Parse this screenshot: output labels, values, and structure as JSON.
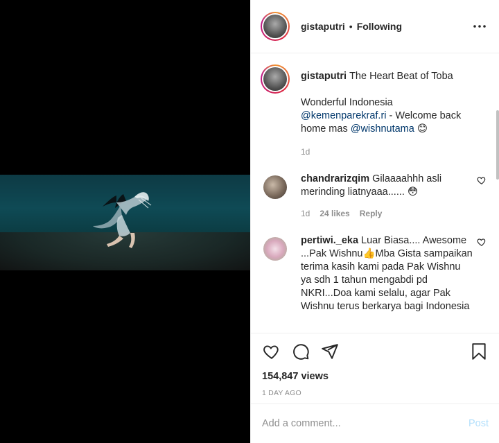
{
  "header": {
    "username": "gistaputri",
    "separator": "•",
    "follow_status": "Following"
  },
  "caption": {
    "username": "gistaputri",
    "title": "The Heart Beat of Toba",
    "line1": "Wonderful Indonesia",
    "mention1": "@kemenparekraf.ri",
    "mid_text": " - Welcome back home mas ",
    "mention2": "@wishnutama",
    "emoji": "😊",
    "time": "1d"
  },
  "comments": [
    {
      "username": "chandrarizqim",
      "text": "Gilaaaahhh asli merinding liatnyaaa...... 😳",
      "time": "1d",
      "likes": "24 likes",
      "reply": "Reply"
    },
    {
      "username": "pertiwi._eka",
      "text": "Luar Biasa.... Awesome ...Pak Wishnu👍Mba Gista sampaikan terima kasih kami pada Pak Wishnu ya sdh 1 tahun mengabdi pd NKRI...Doa kami selalu, agar Pak Wishnu terus berkarya bagi Indonesia"
    }
  ],
  "stats": {
    "views": "154,847 views",
    "posted": "1 DAY AGO"
  },
  "add_comment": {
    "placeholder": "Add a comment...",
    "post_label": "Post"
  },
  "icons": {
    "more": "more-options-icon",
    "like": "heart-icon",
    "comment": "comment-icon",
    "share": "share-icon",
    "save": "bookmark-icon"
  },
  "colors": {
    "text": "#262626",
    "muted": "#8e8e8e",
    "link": "#00376b",
    "post_disabled": "#b2dffc"
  }
}
